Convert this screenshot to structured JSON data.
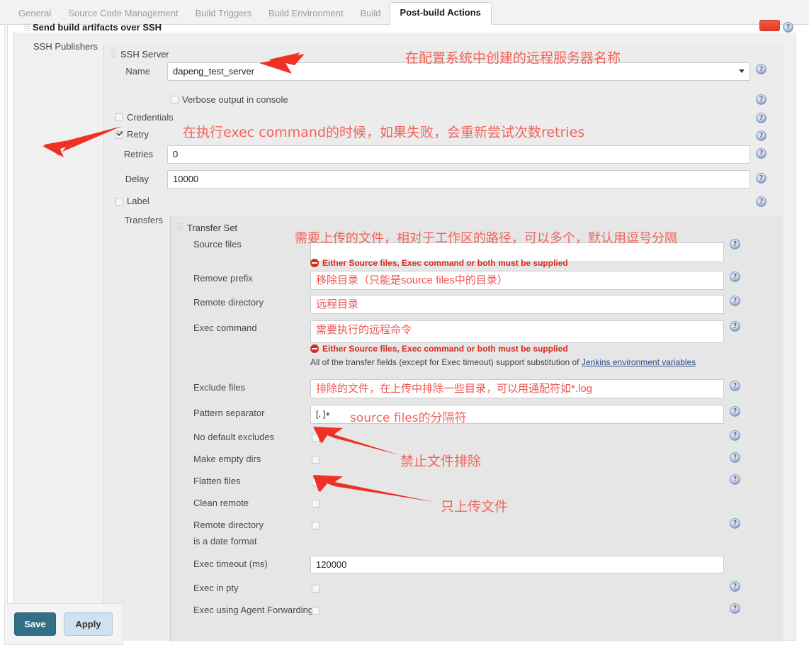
{
  "tabs": [
    {
      "label": "General",
      "active": false
    },
    {
      "label": "Source Code Management",
      "active": false
    },
    {
      "label": "Build Triggers",
      "active": false
    },
    {
      "label": "Build Environment",
      "active": false
    },
    {
      "label": "Build",
      "active": false
    },
    {
      "label": "Post-build Actions",
      "active": true
    }
  ],
  "section": {
    "title": "Send build artifacts over SSH",
    "publishers_label": "SSH Publishers",
    "delete_button_label": ""
  },
  "ssh_server": {
    "block_title": "SSH Server",
    "name_label": "Name",
    "name_value": "dapeng_test_server",
    "verbose_label": "Verbose output in console",
    "verbose_checked": false,
    "credentials_label": "Credentials",
    "credentials_checked": false,
    "retry_label": "Retry",
    "retry_checked": true,
    "retries_label": "Retries",
    "retries_value": "0",
    "delay_label": "Delay",
    "delay_value": "10000",
    "label_label": "Label",
    "label_checked": false,
    "transfers_label": "Transfers"
  },
  "transfer_set": {
    "block_title": "Transfer Set",
    "source_files_label": "Source files",
    "source_files_value": "",
    "remove_prefix_label": "Remove prefix",
    "remove_prefix_value": "移除目录（只能是source files中的目录）",
    "remote_directory_label": "Remote directory",
    "remote_directory_value": "远程目录",
    "exec_command_label": "Exec command",
    "exec_command_value": "需要执行的远程命令",
    "exclude_files_label": "Exclude files",
    "exclude_files_value": "排除的文件，在上传中排除一些目录，可以用通配符如*.log",
    "pattern_separator_label": "Pattern separator",
    "pattern_separator_value": "[, ]+",
    "no_default_excludes_label": "No default excludes",
    "no_default_excludes_checked": false,
    "make_empty_dirs_label": "Make empty dirs",
    "make_empty_dirs_checked": false,
    "flatten_files_label": "Flatten files",
    "flatten_files_checked": false,
    "clean_remote_label": "Clean remote",
    "clean_remote_checked": false,
    "remote_dir_date_label_1": "Remote directory",
    "remote_dir_date_label_2": "is a date format",
    "remote_dir_date_checked": false,
    "exec_timeout_label": "Exec timeout (ms)",
    "exec_timeout_value": "120000",
    "exec_in_pty_label": "Exec in pty",
    "exec_in_pty_checked": false,
    "exec_agent_forwarding_label": "Exec using Agent Forwarding",
    "exec_agent_forwarding_checked": false
  },
  "messages": {
    "error_source_1": "Either Source files, Exec command or both must be supplied",
    "error_source_2": "Either Source files, Exec command or both must be supplied",
    "substitution_note_prefix": "All of the transfer fields (except for Exec timeout) support substitution of ",
    "substitution_note_link": "Jenkins environment variables"
  },
  "annotations": {
    "server_name": "在配置系统中创建的远程服务器名称",
    "retry": "在执行exec command的时候，如果失败，会重新尝试次数retries",
    "source_files": "需要上传的文件，相对于工作区的路径，可以多个，默认用逗号分隔",
    "pattern_separator": "source files的分隔符",
    "no_default_excludes": "禁止文件排除",
    "flatten_files": "只上传文件"
  },
  "footer": {
    "save_label": "Save",
    "apply_label": "Apply"
  },
  "icons": {
    "help": "?"
  },
  "colors": {
    "annotation_red": "#f0645a",
    "error_red": "#d9291c",
    "save_teal": "#336f86",
    "apply_blue": "#cfe2f0",
    "arrow_red": "#ee3124"
  }
}
